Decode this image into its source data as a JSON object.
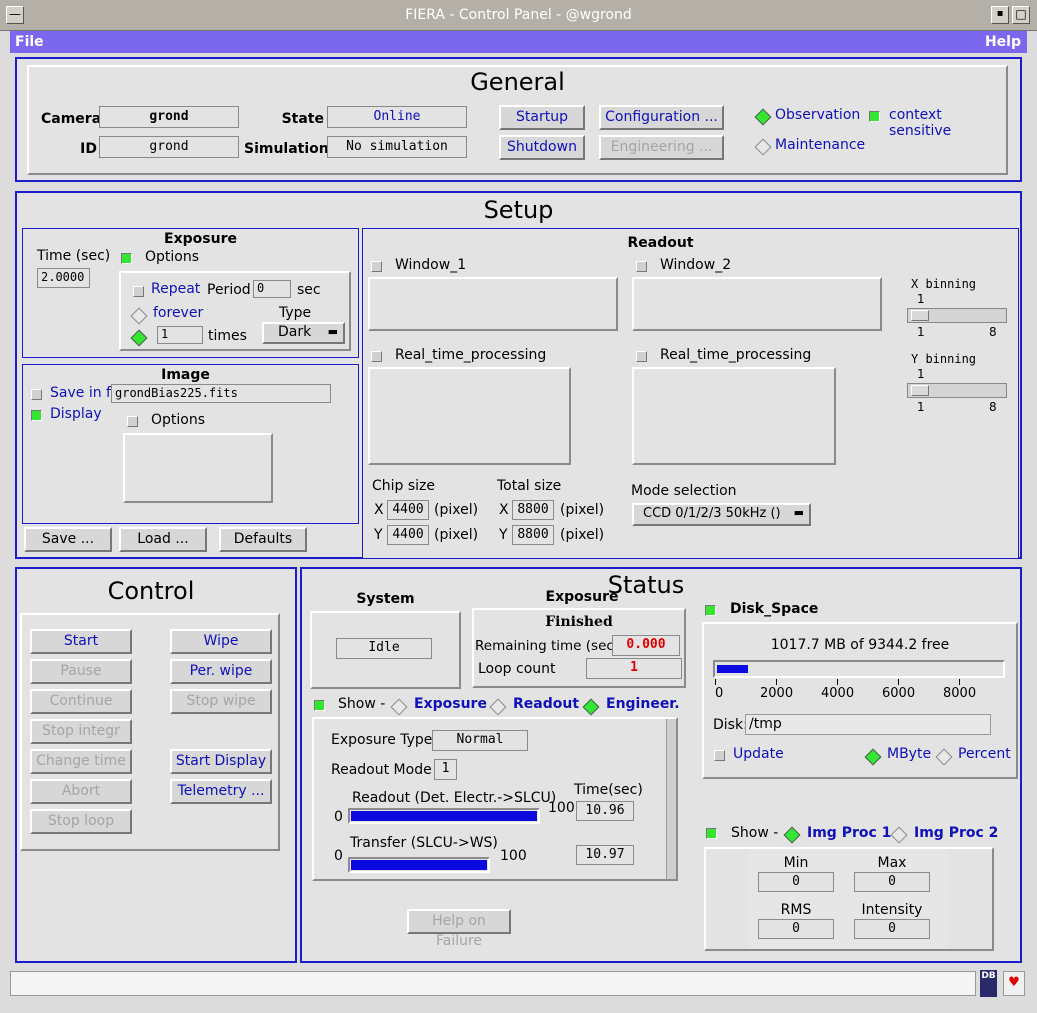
{
  "window": {
    "title": "FIERA - Control Panel - @wgrond"
  },
  "menu": {
    "file": "File",
    "help": "Help"
  },
  "general": {
    "title": "General",
    "camera_label": "Camera",
    "camera_value": "grond",
    "id_label": "ID",
    "id_value": "grond",
    "state_label": "State",
    "state_value": "Online",
    "simulation_label": "Simulation",
    "simulation_value": "No simulation",
    "startup": "Startup",
    "shutdown": "Shutdown",
    "configuration": "Configuration ...",
    "engineering": "Engineering ...",
    "observation": "Observation",
    "maintenance": "Maintenance",
    "context_sensitive": "context sensitive"
  },
  "setup": {
    "title": "Setup",
    "exposure": {
      "title": "Exposure",
      "time_label": "Time (sec)",
      "time_value": "2.0000",
      "options": "Options",
      "repeat": "Repeat",
      "period_label": "Period",
      "period_value": "0",
      "sec": "sec",
      "forever": "forever",
      "times_value": "1",
      "times": "times",
      "type_label": "Type",
      "type_value": "Dark"
    },
    "image": {
      "title": "Image",
      "save_in_file": "Save in file",
      "file_value": "grondBias225.fits",
      "display": "Display",
      "options": "Options"
    },
    "buttons": {
      "save": "Save ...",
      "load": "Load ...",
      "defaults": "Defaults"
    },
    "readout": {
      "title": "Readout",
      "window1": "Window_1",
      "window2": "Window_2",
      "rtp1": "Real_time_processing",
      "rtp2": "Real_time_processing",
      "chip_size": "Chip size",
      "total_size": "Total size",
      "x": "X",
      "y": "Y",
      "pixel": "(pixel)",
      "chip_x": "4400",
      "chip_y": "4400",
      "total_x": "8800",
      "total_y": "8800",
      "mode_label": "Mode selection",
      "mode_value": "CCD 0/1/2/3 50kHz ()",
      "xbin_label": "X binning",
      "xbin_value": "1",
      "xbin_min": "1",
      "xbin_max": "8",
      "ybin_label": "Y binning",
      "ybin_value": "1",
      "ybin_min": "1",
      "ybin_max": "8"
    }
  },
  "control": {
    "title": "Control",
    "start": "Start",
    "pause": "Pause",
    "continue": "Continue",
    "stop_integr": "Stop integr",
    "change_time": "Change time",
    "abort": "Abort",
    "stop_loop": "Stop loop",
    "wipe": "Wipe",
    "per_wipe": "Per. wipe",
    "stop_wipe": "Stop wipe",
    "start_display": "Start Display",
    "telemetry": "Telemetry ..."
  },
  "status": {
    "title": "Status",
    "system_title": "System",
    "system_value": "Idle",
    "exposure_title": "Exposure",
    "exposure_state": "Finished",
    "remaining_label": "Remaining time (sec)",
    "remaining_value": "0.000",
    "loop_label": "Loop count",
    "loop_value": "1",
    "show": "Show -",
    "tab_exposure": "Exposure",
    "tab_readout": "Readout",
    "tab_engineer": "Engineer.",
    "exposure_type_label": "Exposure Type",
    "exposure_type_value": "Normal",
    "readout_mode_label": "Readout Mode",
    "readout_mode_value": "1",
    "time_sec": "Time(sec)",
    "readout_label": "Readout (Det. Electr.->SLCU)",
    "readout_min": "0",
    "readout_max": "100",
    "readout_time": "10.96",
    "readout_progress": 1.0,
    "transfer_label": "Transfer (SLCU->WS)",
    "transfer_min": "0",
    "transfer_max": "100",
    "transfer_time": "10.97",
    "transfer_progress": 1.0,
    "help_failure": "Help on Failure",
    "disk_title": "Disk_Space",
    "disk_free": "1017.7 MB of 9344.2 free",
    "disk_ticks": [
      "0",
      "2000",
      "4000",
      "6000",
      "8000"
    ],
    "disk_used_fraction": 0.109,
    "disk_label": "Disk:",
    "disk_path": "/tmp",
    "update": "Update",
    "mbyte": "MByte",
    "percent": "Percent",
    "imgproc_show": "Show -",
    "img_proc1": "Img Proc 1",
    "img_proc2": "Img Proc 2",
    "min_label": "Min",
    "min_value": "0",
    "max_label": "Max",
    "max_value": "0",
    "rms_label": "RMS",
    "rms_value": "0",
    "intensity_label": "Intensity",
    "intensity_value": "0"
  },
  "bottom": {
    "message": "",
    "db_icon_text": "DB"
  }
}
